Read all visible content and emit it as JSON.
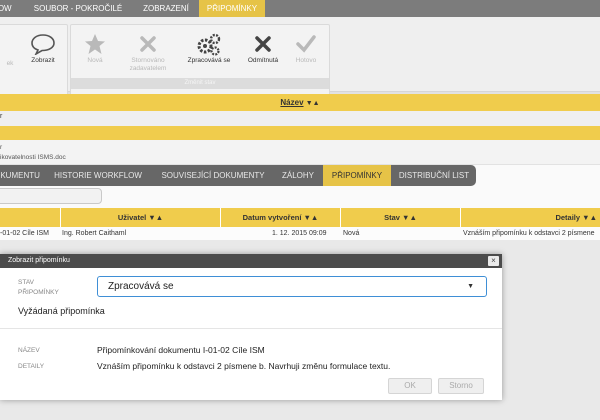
{
  "top_tabs": [
    {
      "label": "LOW",
      "active": false
    },
    {
      "label": "SOUBOR - POKROČILÉ",
      "active": false
    },
    {
      "label": "ZOBRAZENÍ",
      "active": false
    },
    {
      "label": "PŘIPOMÍNKY",
      "active": true
    }
  ],
  "ribbon": {
    "partial_label": "ek",
    "show_button": "Zobrazit",
    "status_buttons": [
      {
        "label": "Nová",
        "icon": "star-icon",
        "enabled": false
      },
      {
        "label": "Stornováno zadavatelem",
        "icon": "x-icon",
        "enabled": false
      },
      {
        "label": "Zpracovává se",
        "icon": "gears-icon",
        "enabled": true
      },
      {
        "label": "Odmítnutá",
        "icon": "x-icon",
        "enabled": true
      },
      {
        "label": "Hotovo",
        "icon": "check-icon",
        "enabled": false
      }
    ],
    "status_group_caption": "Změnit stav"
  },
  "upper_grid": {
    "column_name": "Název",
    "sort_glyph": "▼▲",
    "row1_fragment": "r",
    "row2_fragment": "ikovatelnosti ISMS.doc"
  },
  "tabs2": [
    {
      "label": "OKUMENTU",
      "active": false
    },
    {
      "label": "HISTORIE WORKFLOW",
      "active": false
    },
    {
      "label": "SOUVISEJÍCÍ DOKUMENTY",
      "active": false
    },
    {
      "label": "ZÁLOHY",
      "active": false
    },
    {
      "label": "PŘIPOMÍNKY",
      "active": true
    },
    {
      "label": "DISTRIBUČNÍ LIST",
      "active": false
    }
  ],
  "grid": {
    "headers": [
      "Uživatel ▼▲",
      "Datum vytvoření ▼▲",
      "Stav ▼▲",
      "Detaily ▼▲"
    ],
    "row": {
      "name": "-01-02 Cíle ISM",
      "user": "Ing. Robert Caithaml",
      "date": "1. 12. 2015 09:09",
      "status": "Nová",
      "details": "Vznáším připomínku k odstavci 2 písmene"
    }
  },
  "modal": {
    "title": "Zobrazit připomínku",
    "close_glyph": "×",
    "status_label_line1": "STAV",
    "status_label_line2": "PŘIPOMÍNKY",
    "status_value": "Zpracovává se",
    "requested_text": "Vyžádaná připomínka",
    "name_label": "NÁZEV",
    "name_value": "Připomínkování dokumentu I-01-02 Cíle ISM",
    "details_label": "DETAILY",
    "details_value": "Vznáším připomínku k odstavci 2 písmene b. Navrhuji změnu formulace textu.",
    "ok_button": "OK",
    "cancel_button": "Storno"
  },
  "colors": {
    "accent_yellow": "#e6c347",
    "header_yellow": "#f0cc4c",
    "dark_tab": "#676767",
    "focus_blue": "#3f8fd6"
  }
}
